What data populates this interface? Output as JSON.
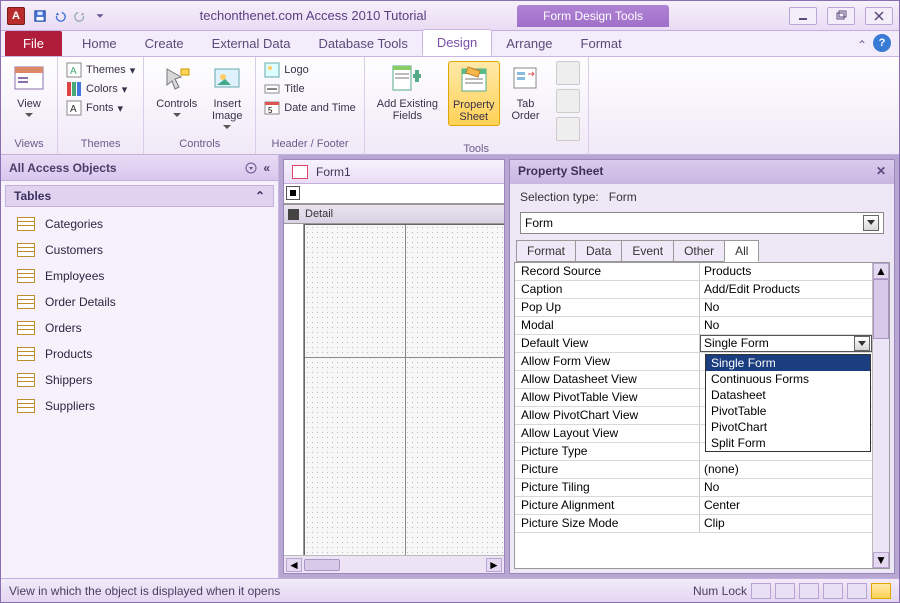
{
  "title": "techonthenet.com Access 2010 Tutorial",
  "context_title": "Form Design Tools",
  "tabs": {
    "file": "File",
    "home": "Home",
    "create": "Create",
    "external": "External Data",
    "dbtools": "Database Tools",
    "design": "Design",
    "arrange": "Arrange",
    "format": "Format"
  },
  "ribbon": {
    "views": {
      "label": "Views",
      "view": "View"
    },
    "themes": {
      "label": "Themes",
      "themes": "Themes",
      "colors": "Colors",
      "fonts": "Fonts"
    },
    "controls": {
      "label": "Controls",
      "controls": "Controls",
      "insert": "Insert\nImage"
    },
    "header": {
      "label": "Header / Footer",
      "logo": "Logo",
      "title": "Title",
      "date": "Date and Time"
    },
    "tools": {
      "label": "Tools",
      "addfields": "Add Existing\nFields",
      "propsheet": "Property\nSheet",
      "taborder": "Tab\nOrder"
    }
  },
  "nav": {
    "header": "All Access Objects",
    "section": "Tables",
    "items": [
      "Categories",
      "Customers",
      "Employees",
      "Order Details",
      "Orders",
      "Products",
      "Shippers",
      "Suppliers"
    ]
  },
  "form_tab": "Form1",
  "detail_label": "Detail",
  "prop": {
    "title": "Property Sheet",
    "seltype_lbl": "Selection type:",
    "seltype_val": "Form",
    "combo": "Form",
    "tabs": {
      "format": "Format",
      "data": "Data",
      "event": "Event",
      "other": "Other",
      "all": "All"
    },
    "rows": [
      {
        "name": "Record Source",
        "value": "Products"
      },
      {
        "name": "Caption",
        "value": "Add/Edit Products"
      },
      {
        "name": "Pop Up",
        "value": "No"
      },
      {
        "name": "Modal",
        "value": "No"
      },
      {
        "name": "Default View",
        "value": "Single Form",
        "selected": true
      },
      {
        "name": "Allow Form View",
        "value": ""
      },
      {
        "name": "Allow Datasheet View",
        "value": ""
      },
      {
        "name": "Allow PivotTable View",
        "value": ""
      },
      {
        "name": "Allow PivotChart View",
        "value": ""
      },
      {
        "name": "Allow Layout View",
        "value": ""
      },
      {
        "name": "Picture Type",
        "value": ""
      },
      {
        "name": "Picture",
        "value": "(none)"
      },
      {
        "name": "Picture Tiling",
        "value": "No"
      },
      {
        "name": "Picture Alignment",
        "value": "Center"
      },
      {
        "name": "Picture Size Mode",
        "value": "Clip"
      }
    ],
    "dropdown": {
      "options": [
        "Single Form",
        "Continuous Forms",
        "Datasheet",
        "PivotTable",
        "PivotChart",
        "Split Form"
      ],
      "selected": "Single Form"
    }
  },
  "status": {
    "msg": "View in which the object is displayed when it opens",
    "numlock": "Num Lock"
  }
}
